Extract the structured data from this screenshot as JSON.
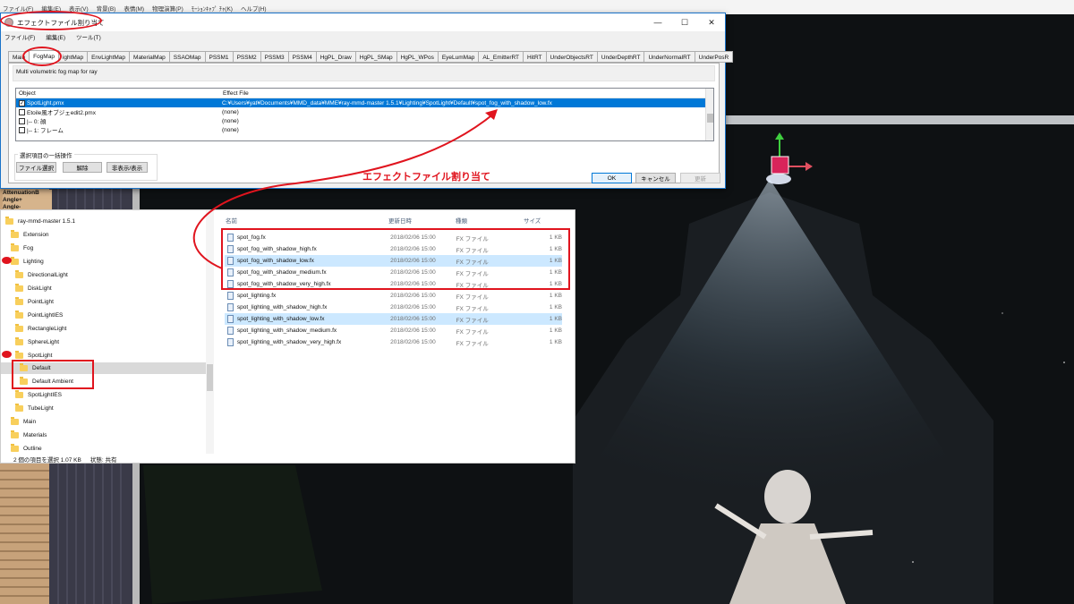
{
  "app_menu": [
    "ファイル(F)",
    "編集(E)",
    "表示(V)",
    "背景(B)",
    "表情(M)",
    "物理演算(P)",
    "ﾓｰｼｮﾝｷｬﾌﾟ ﾁｬ(K)",
    "ヘルプ(H)"
  ],
  "dialog": {
    "title": "エフェクトファイル割り当て",
    "window_buttons": {
      "minimize": "—",
      "maximize": "☐",
      "close": "✕"
    },
    "menu": [
      "ファイル(F)",
      "編集(E)",
      "ツール(T)"
    ],
    "tabs": [
      "Main",
      "FogMap",
      "LightMap",
      "EnvLightMap",
      "MaterialMap",
      "SSAOMap",
      "PSSM1",
      "PSSM2",
      "PSSM3",
      "PSSM4",
      "HgPL_Draw",
      "HgPL_SMap",
      "HgPL_WPos",
      "EyeLumMap",
      "AL_EmitterRT",
      "HitRT",
      "UnderObjectsRT",
      "UnderDepthRT",
      "UnderNormalRT",
      "UnderPosRT"
    ],
    "tab_labels_shown": [
      "Main",
      "FogMap",
      "ightMap",
      "EnvLightMap",
      "MaterialMap",
      "SSAOMap",
      "PSSM1",
      "PSSM2",
      "PSSM3",
      "PSSM4",
      "HgPL_Draw",
      "HgPL_SMap",
      "HgPL_WPos",
      "EyeLumMap",
      "AL_EmitterRT",
      "HitRT",
      "UnderObjectsRT",
      "UnderDepthRT",
      "UnderNormalRT",
      "UnderPosR"
    ],
    "active_tab": "FogMap",
    "description": "Multi volumetric fog map for ray",
    "grid": {
      "headers": [
        "Object",
        "Effect File"
      ],
      "rows": [
        {
          "object": "SpotLight.pmx",
          "effect": "C:¥Users¥yat¥Documents¥MMD_data¥MME¥ray-mmd-master 1.5.1¥Lighting¥SpotLight¥Default¥spot_fog_with_shadow_low.fx",
          "checked": true,
          "selected": true
        },
        {
          "object": "Etoile風オブジェedit2.pmx",
          "effect": "(none)",
          "checked": false,
          "selected": false
        },
        {
          "object": "  |-- 0: 顔",
          "effect": "(none)",
          "checked": false,
          "selected": false
        },
        {
          "object": "  |-- 1: フレーム",
          "effect": "(none)",
          "checked": false,
          "selected": false
        }
      ]
    },
    "group_label": "選択項目の一括操作",
    "buttons": {
      "select_file": "ファイル選択",
      "remove": "解除",
      "toggle_visibility": "非表示/表示",
      "ok": "OK",
      "cancel": "キャンセル",
      "update": "更新"
    }
  },
  "timeline_labels": [
    "AttenuationB",
    "Angle+",
    "Angle-"
  ],
  "annotation": "エフェクトファイル割り当て",
  "explorer": {
    "tree": [
      {
        "label": "ray-mmd-master 1.5.1",
        "level": 0
      },
      {
        "label": "Extension",
        "level": 1
      },
      {
        "label": "Fog",
        "level": 1
      },
      {
        "label": "Lighting",
        "level": 1
      },
      {
        "label": "DirectionalLight",
        "level": 2
      },
      {
        "label": "DiskLight",
        "level": 2
      },
      {
        "label": "PointLight",
        "level": 2
      },
      {
        "label": "PointLightIES",
        "level": 2
      },
      {
        "label": "RectangleLight",
        "level": 2
      },
      {
        "label": "SphereLight",
        "level": 2
      },
      {
        "label": "SpotLight",
        "level": 2
      },
      {
        "label": "Default",
        "level": 3,
        "selected": true
      },
      {
        "label": "Default Ambient",
        "level": 3
      },
      {
        "label": "SpotLightIES",
        "level": 2
      },
      {
        "label": "TubeLight",
        "level": 2
      },
      {
        "label": "Main",
        "level": 1
      },
      {
        "label": "Materials",
        "level": 1
      },
      {
        "label": "Outline",
        "level": 1
      }
    ],
    "status_count": "2 個の項目を選択  1.07 KB",
    "status_state": "状態: 共有",
    "file_headers": {
      "name": "名前",
      "modified": "更新日時",
      "type": "種類",
      "size": "サイズ"
    },
    "files": [
      {
        "name": "spot_fog.fx",
        "date": "2018/02/06 15:00",
        "type": "FX ファイル",
        "size": "1 KB",
        "selected": false
      },
      {
        "name": "spot_fog_with_shadow_high.fx",
        "date": "2018/02/06 15:00",
        "type": "FX ファイル",
        "size": "1 KB",
        "selected": false
      },
      {
        "name": "spot_fog_with_shadow_low.fx",
        "date": "2018/02/06 15:00",
        "type": "FX ファイル",
        "size": "1 KB",
        "selected": true
      },
      {
        "name": "spot_fog_with_shadow_medium.fx",
        "date": "2018/02/06 15:00",
        "type": "FX ファイル",
        "size": "1 KB",
        "selected": false
      },
      {
        "name": "spot_fog_with_shadow_very_high.fx",
        "date": "2018/02/06 15:00",
        "type": "FX ファイル",
        "size": "1 KB",
        "selected": false
      },
      {
        "name": "spot_lighting.fx",
        "date": "2018/02/06 15:00",
        "type": "FX ファイル",
        "size": "1 KB",
        "selected": false
      },
      {
        "name": "spot_lighting_with_shadow_high.fx",
        "date": "2018/02/06 15:00",
        "type": "FX ファイル",
        "size": "1 KB",
        "selected": false
      },
      {
        "name": "spot_lighting_with_shadow_low.fx",
        "date": "2018/02/06 15:00",
        "type": "FX ファイル",
        "size": "1 KB",
        "selected": true
      },
      {
        "name": "spot_lighting_with_shadow_medium.fx",
        "date": "2018/02/06 15:00",
        "type": "FX ファイル",
        "size": "1 KB",
        "selected": false
      },
      {
        "name": "spot_lighting_with_shadow_very_high.fx",
        "date": "2018/02/06 15:00",
        "type": "FX ファイル",
        "size": "1 KB",
        "selected": false
      }
    ]
  },
  "colors": {
    "annotation_red": "#e0141e",
    "selection_blue": "#0078d7",
    "explorer_selection": "#cce8ff",
    "folder": "#f8cf5c"
  }
}
